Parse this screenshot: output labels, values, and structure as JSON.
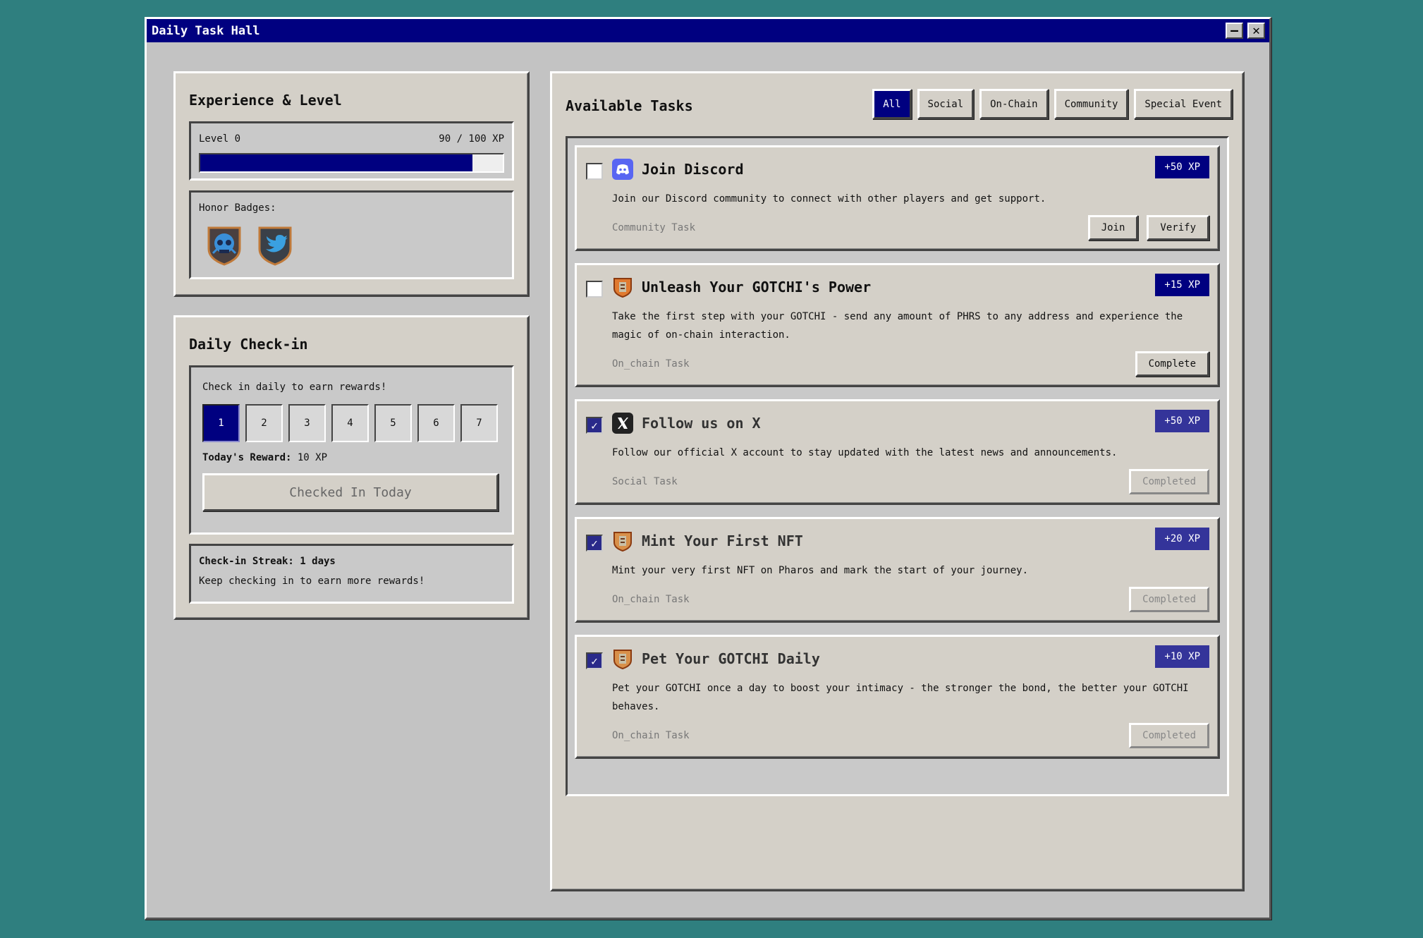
{
  "window": {
    "title": "Daily Task Hall",
    "minimize": "—",
    "close": "✕"
  },
  "experience": {
    "title": "Experience & Level",
    "level_label": "Level 0",
    "xp_text": "90 / 100 XP",
    "xp_fraction": 0.9,
    "badges_label": "Honor Badges:",
    "badges": [
      "skull-badge-icon",
      "twitter-badge-icon"
    ]
  },
  "checkin": {
    "title": "Daily Check-in",
    "prompt": "Check in daily to earn rewards!",
    "days": [
      "1",
      "2",
      "3",
      "4",
      "5",
      "6",
      "7"
    ],
    "active_day": 1,
    "reward_label": "Today's Reward:",
    "reward_value": "10 XP",
    "button_label": "Checked In Today",
    "streak_title": "Check-in Streak: 1 days",
    "streak_text": "Keep checking in to earn more rewards!"
  },
  "tasks": {
    "title": "Available Tasks",
    "tabs": [
      {
        "label": "All",
        "active": true
      },
      {
        "label": "Social",
        "active": false
      },
      {
        "label": "On-Chain",
        "active": false
      },
      {
        "label": "Community",
        "active": false
      },
      {
        "label": "Special Event",
        "active": false
      }
    ],
    "items": [
      {
        "title": "Join Discord",
        "icon": "discord-icon",
        "xp": "+50 XP",
        "checked": false,
        "desc": "Join our Discord community to connect with other players and get support.",
        "category": "Community Task",
        "actions": [
          {
            "label": "Join",
            "disabled": false
          },
          {
            "label": "Verify",
            "disabled": false
          }
        ]
      },
      {
        "title": "Unleash Your GOTCHI's Power",
        "icon": "gotchi-icon",
        "xp": "+15 XP",
        "checked": false,
        "desc": "Take the first step with your GOTCHI - send any amount of PHRS to any address and experience the magic of on-chain interaction.",
        "category": "On_chain Task",
        "actions": [
          {
            "label": "Complete",
            "disabled": false
          }
        ]
      },
      {
        "title": "Follow us on X",
        "icon": "x-icon",
        "xp": "+50 XP",
        "checked": true,
        "desc": "Follow our official X account to stay updated with the latest news and announcements.",
        "category": "Social Task",
        "actions": [
          {
            "label": "Completed",
            "disabled": true
          }
        ]
      },
      {
        "title": "Mint Your First NFT",
        "icon": "gotchi-icon",
        "xp": "+20 XP",
        "checked": true,
        "desc": "Mint your very first NFT on Pharos and mark the start of your journey.",
        "category": "On_chain Task",
        "actions": [
          {
            "label": "Completed",
            "disabled": true
          }
        ]
      },
      {
        "title": "Pet Your GOTCHI Daily",
        "icon": "gotchi-icon",
        "xp": "+10 XP",
        "checked": true,
        "desc": "Pet your GOTCHI once a day to boost your intimacy - the stronger the bond, the better your GOTCHI behaves.",
        "category": "On_chain Task",
        "actions": [
          {
            "label": "Completed",
            "disabled": true
          }
        ]
      }
    ]
  }
}
